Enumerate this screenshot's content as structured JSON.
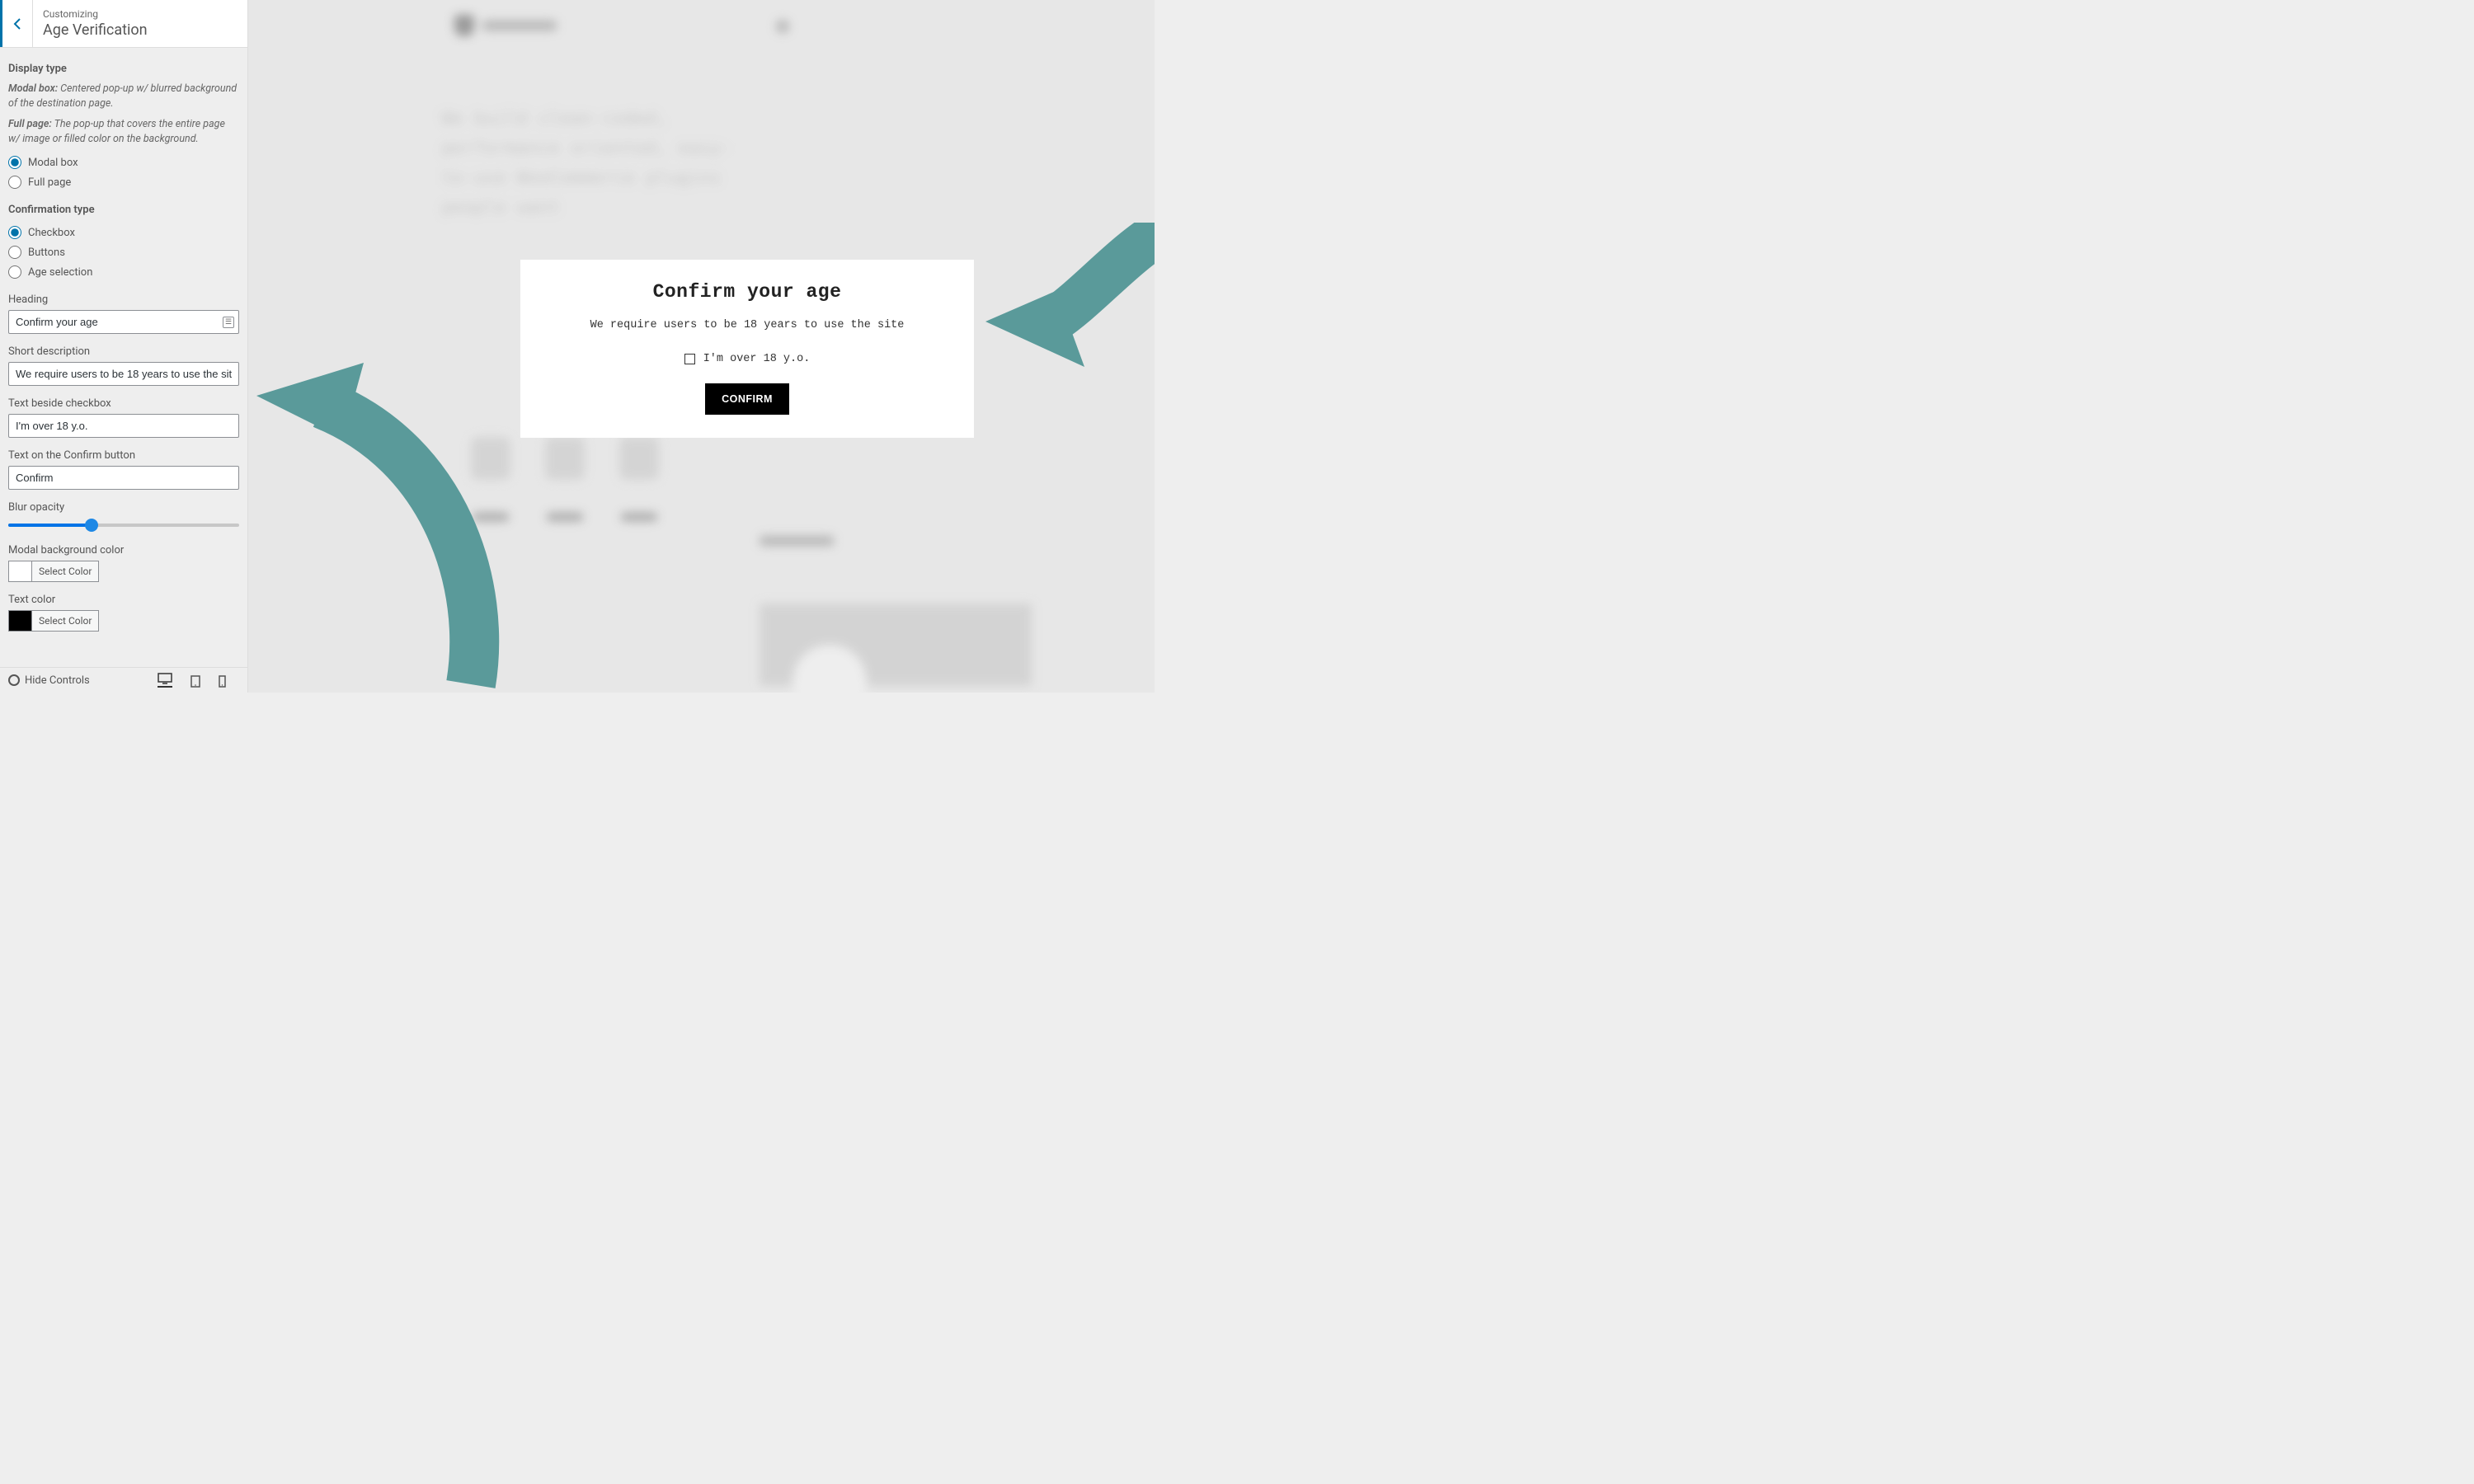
{
  "header": {
    "crumb": "Customizing",
    "title": "Age Verification"
  },
  "display_type": {
    "title": "Display type",
    "modal_label": "Modal box:",
    "modal_desc": " Centered pop-up w/ blurred background of the destination page.",
    "full_label": "Full page:",
    "full_desc": " The pop-up that covers the entire page w/ image or filled color on the background.",
    "options": {
      "modal": "Modal box",
      "full": "Full page"
    },
    "selected": "modal"
  },
  "confirmation_type": {
    "title": "Confirmation type",
    "options": {
      "checkbox": "Checkbox",
      "buttons": "Buttons",
      "age": "Age selection"
    },
    "selected": "checkbox"
  },
  "fields": {
    "heading_label": "Heading",
    "heading_value": "Confirm your age",
    "short_desc_label": "Short description",
    "short_desc_value": "We require users to be 18 years to use the site",
    "checkbox_text_label": "Text beside checkbox",
    "checkbox_text_value": "I'm over 18 y.o.",
    "confirm_btn_label": "Text on the Confirm button",
    "confirm_btn_value": "Confirm",
    "blur_label": "Blur opacity",
    "blur_value_pct": 36,
    "modal_bg_label": "Modal background color",
    "modal_bg_color": "#ffffff",
    "text_color_label": "Text color",
    "text_color": "#000000",
    "select_color": "Select Color"
  },
  "footer": {
    "hide_controls": "Hide Controls"
  },
  "modal": {
    "title": "Confirm your age",
    "desc": "We require users to be 18 years to use the site",
    "checkbox_label": "I'm over 18 y.o.",
    "confirm": "CONFIRM"
  },
  "colors": {
    "accent": "#5a9a9a",
    "wp_blue": "#0073aa"
  }
}
